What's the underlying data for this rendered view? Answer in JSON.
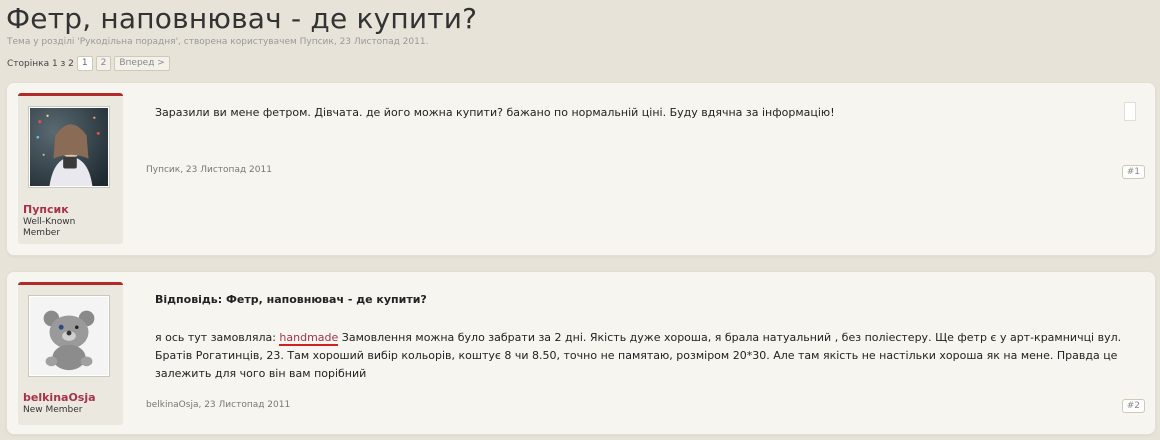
{
  "thread": {
    "title": "Фетр, наповнювач - де купити?",
    "subtitle": "Тема у розділі 'Рукодільна порадня', створена користувачем Пупсик, 23 Листопад 2011."
  },
  "pagination": {
    "label": "Сторінка 1 з 2",
    "pages": [
      "1",
      "2"
    ],
    "next": "Вперед >"
  },
  "posts": [
    {
      "username": "Пупсик",
      "user_title": "Well-Known Member",
      "message": "Заразили ви мене фетром. Дівчата. де його можна купити? бажано по нормальній ціні. Буду вдячна за інформацію!",
      "meta": "Пупсик, 23 Листопад 2011",
      "number": "#1"
    },
    {
      "username": "belkinaOsja",
      "user_title": "New Member",
      "reply_title": "Відповідь: Фетр, наповнювач - де купити?",
      "message_before": "я ось тут замовляла: ",
      "link_text": "handmade",
      "message_after": " Замовлення можна було забрати за 2 дні. Якість дуже хороша, я брала натуальний , без поліестеру. Ще фетр є у арт-крамничці вул. Братів Рогатинців, 23. Там хороший вибір кольорів, коштує 8 чи 8.50, точно не памятаю, розміром 20*30. Але там якість не настільки хороша як на мене. Правда це залежить для чого він вам порібний",
      "meta": "belkinaOsja, 23 Листопад 2011",
      "number": "#2"
    }
  ],
  "colors": {
    "accent": "#b32a2a",
    "username": "#a8324a",
    "background": "#e7e3d9"
  }
}
